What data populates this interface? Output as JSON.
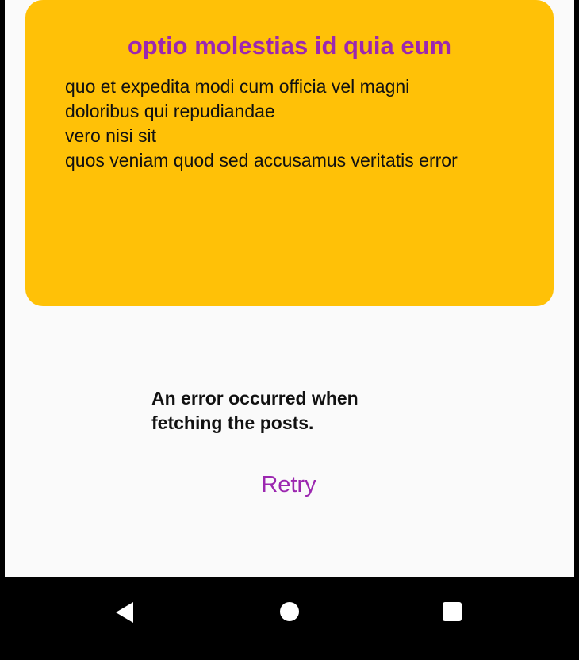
{
  "post": {
    "title": "optio molestias id quia eum",
    "body": "quo et expedita modi cum officia vel magni\ndoloribus qui repudiandae\nvero nisi sit\nquos veniam quod sed accusamus veritatis error"
  },
  "error": {
    "message": "An error occurred when fetching the posts.",
    "retry_label": "Retry"
  },
  "navigation": {
    "buttons": [
      "back-icon",
      "home-icon",
      "recents-icon"
    ]
  },
  "colors": {
    "card_background": "#ffc107",
    "accent": "#9c27b0",
    "screen_background": "#fafafa",
    "nav_background": "#000000"
  }
}
